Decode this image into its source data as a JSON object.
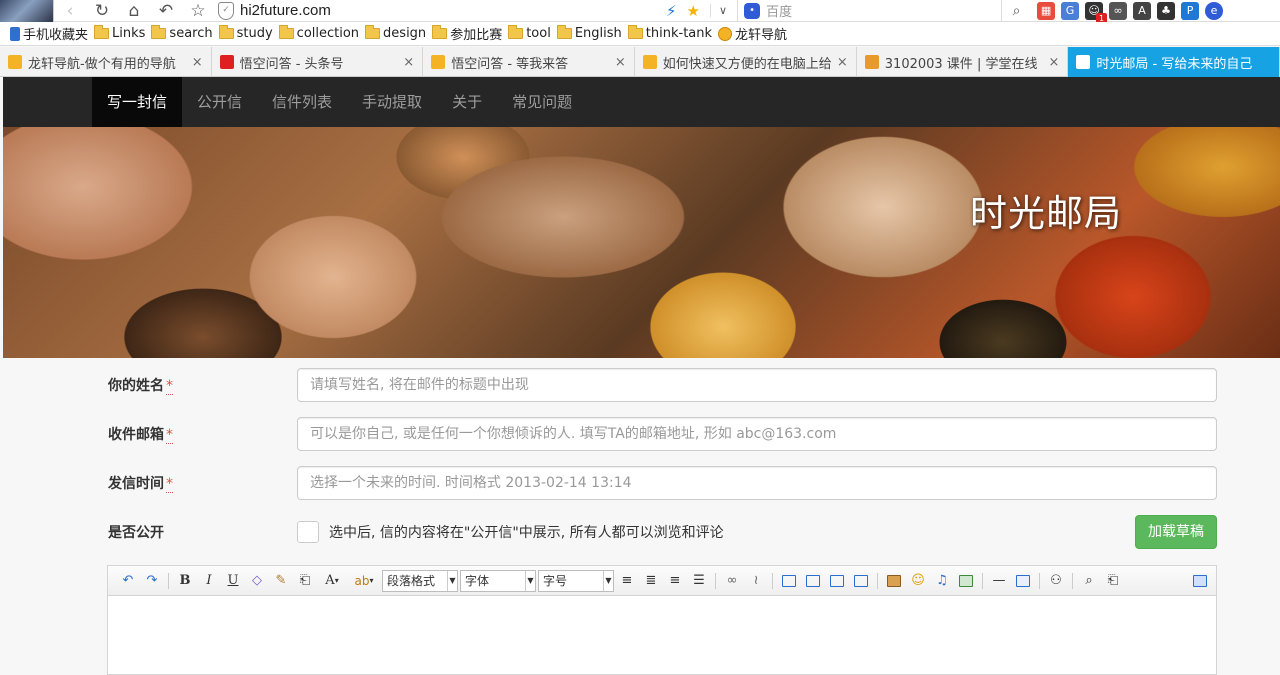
{
  "browser": {
    "url": "hi2future.com",
    "search_placeholder": "百度",
    "bookmarks": [
      {
        "label": "手机收藏夹",
        "icon": "phone-icon"
      },
      {
        "label": "Links",
        "icon": "folder-icon"
      },
      {
        "label": "search",
        "icon": "folder-icon"
      },
      {
        "label": "study",
        "icon": "folder-icon"
      },
      {
        "label": "collection",
        "icon": "folder-icon"
      },
      {
        "label": "design",
        "icon": "folder-icon"
      },
      {
        "label": "参加比赛",
        "icon": "folder-icon"
      },
      {
        "label": "tool",
        "icon": "folder-icon"
      },
      {
        "label": "English",
        "icon": "folder-icon"
      },
      {
        "label": "think-tank",
        "icon": "folder-icon"
      },
      {
        "label": "龙轩导航",
        "icon": "cat-icon"
      }
    ],
    "tabs": [
      {
        "label": "龙轩导航-做个有用的导航",
        "close": "×",
        "favicon_color": "#f4b325"
      },
      {
        "label": "悟空问答 - 头条号",
        "close": "×",
        "favicon_color": "#e02020"
      },
      {
        "label": "悟空问答 - 等我来答",
        "close": "×",
        "favicon_color": "#f4b325"
      },
      {
        "label": "如何快速又方便的在电脑上给图",
        "close": "×",
        "favicon_color": "#f4b325"
      },
      {
        "label": "3102003 课件 | 学堂在线",
        "close": "×",
        "favicon_color": "#e89a2c"
      },
      {
        "label": "时光邮局 - 写给未来的自己",
        "close": "",
        "favicon_color": "#ffffff"
      }
    ],
    "extension_badge": "1"
  },
  "nav": {
    "items": [
      "写一封信",
      "公开信",
      "信件列表",
      "手动提取",
      "关于",
      "常见问题"
    ],
    "active_index": 0
  },
  "hero": {
    "title": "时光邮局"
  },
  "form": {
    "name_label": "你的姓名",
    "name_placeholder": "请填写姓名, 将在邮件的标题中出现",
    "email_label": "收件邮箱",
    "email_placeholder": "可以是你自己, 或是任何一个你想倾诉的人. 填写TA的邮箱地址, 形如 abc@163.com",
    "time_label": "发信时间",
    "time_placeholder": "选择一个未来的时间. 时间格式 2013-02-14 13:14",
    "public_label": "是否公开",
    "public_hint": "选中后, 信的内容将在\"公开信\"中展示, 所有人都可以浏览和评论",
    "required_mark": "*",
    "draft_button": "加载草稿"
  },
  "editor": {
    "paragraph_format": "段落格式",
    "font_family": "字体",
    "font_size": "字号",
    "bold": "B",
    "italic": "I",
    "underline": "U",
    "font_color": "A",
    "highlight": "ab"
  },
  "colors": {
    "accent_tab": "#17a3e3",
    "nav_bg": "#262626",
    "nav_active": "#090909",
    "draft_button": "#5cb85c",
    "required": "#d9534f"
  }
}
